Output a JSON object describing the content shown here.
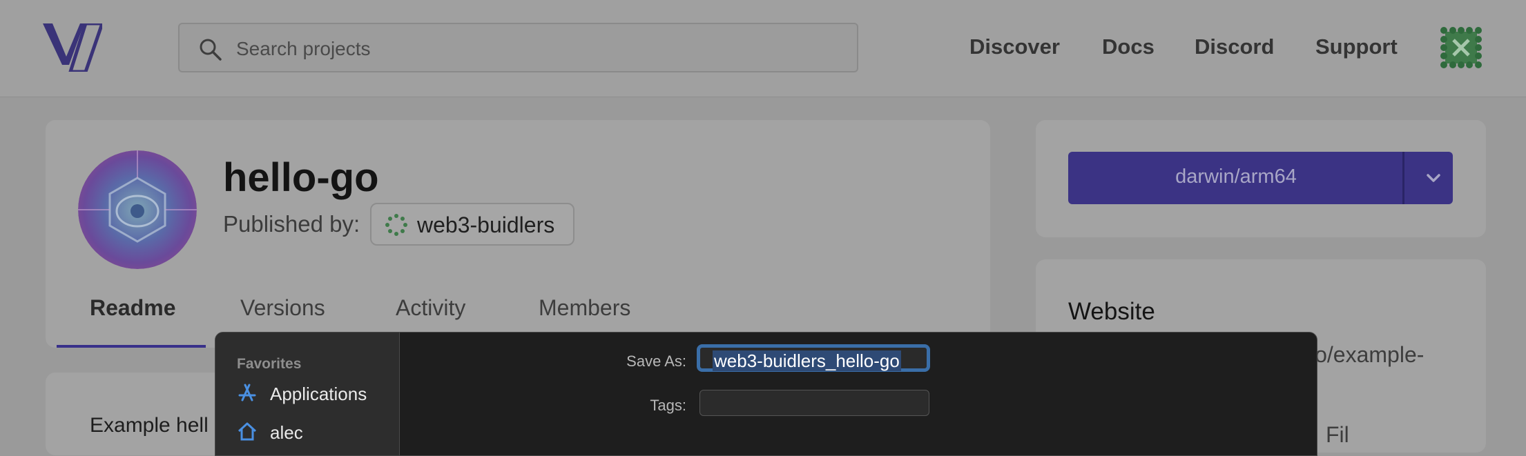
{
  "header": {
    "search_placeholder": "Search projects",
    "nav": [
      "Discover",
      "Docs",
      "Discord",
      "Support"
    ]
  },
  "project": {
    "title": "hello-go",
    "published_by_label": "Published by:",
    "publisher": "web3-buidlers",
    "tabs": [
      "Readme",
      "Versions",
      "Activity",
      "Members"
    ],
    "active_tab": "Readme",
    "readme_text": "Example hell"
  },
  "sidebar": {
    "platform": "darwin/arm64",
    "website_title": "Website",
    "website_url_partial": "io/example-",
    "partial_text": "Fil"
  },
  "save_dialog": {
    "favorites_label": "Favorites",
    "favorites": [
      {
        "label": "Applications",
        "icon": "applications-icon"
      },
      {
        "label": "alec",
        "icon": "home-icon"
      }
    ],
    "save_as_label": "Save As:",
    "save_as_value": "web3-buidlers_hello-go",
    "tags_label": "Tags:",
    "tags_value": ""
  },
  "colors": {
    "accent": "#3b3384",
    "dialog_bg": "#1e1e1e",
    "selection": "#2e4a75",
    "focus_ring": "#3a6ea8"
  }
}
